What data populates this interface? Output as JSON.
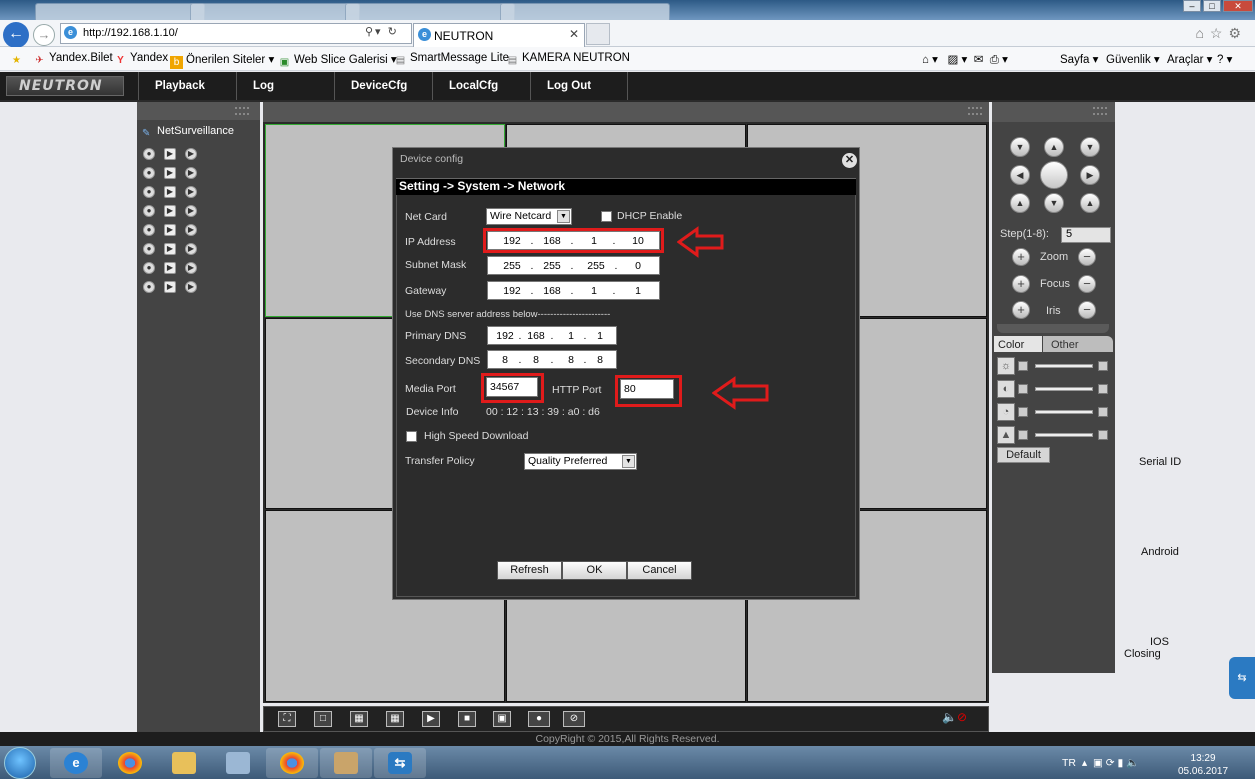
{
  "browser": {
    "url": "http://192.168.1.10/",
    "tab_title": "NEUTRON",
    "favorites": [
      {
        "label": "Yandex.Bilet",
        "icon": "airplane-icon"
      },
      {
        "label": "Yandex",
        "icon": "yandex-icon"
      },
      {
        "label": "Önerilen Siteler ▾",
        "icon": "suggested-sites-icon"
      },
      {
        "label": "Web Slice Galerisi ▾",
        "icon": "web-slice-icon"
      },
      {
        "label": "SmartMessage Lite",
        "icon": "page-icon"
      },
      {
        "label": "KAMERA NEUTRON",
        "icon": "page-icon"
      }
    ],
    "commands": {
      "page": "Sayfa ▾",
      "security": "Güvenlik ▾",
      "tools": "Araçlar ▾",
      "help": "? ▾"
    }
  },
  "app": {
    "logo": "NEUTRON",
    "menu": [
      "Playback",
      "Log",
      "DeviceCfg",
      "LocalCfg",
      "Log Out"
    ],
    "tree_title": "NetSurveillance",
    "copyright": "CopyRight © 2015,All Rights Reserved."
  },
  "ptz": {
    "step_label": "Step(1-8):",
    "step_value": "5",
    "zoom": "Zoom",
    "focus": "Focus",
    "iris": "Iris",
    "tab_color": "Color",
    "tab_other": "Other",
    "default_btn": "Default"
  },
  "side_labels": {
    "serial": "Serial ID",
    "android": "Android",
    "ios": "IOS",
    "closing": "Closing"
  },
  "dialog": {
    "title": "Device config",
    "path": "Setting -> System -> Network",
    "net_card_label": "Net Card",
    "net_card_value": "Wire Netcard",
    "dhcp_label": "DHCP Enable",
    "ip_label": "IP Address",
    "ip": [
      "192",
      "168",
      "1",
      "10"
    ],
    "subnet_label": "Subnet Mask",
    "subnet": [
      "255",
      "255",
      "255",
      "0"
    ],
    "gateway_label": "Gateway",
    "gateway": [
      "192",
      "168",
      "1",
      "1"
    ],
    "dns_note": "Use DNS server address below-----------------------",
    "primary_dns_label": "Primary DNS",
    "primary_dns": [
      "192",
      "168",
      "1",
      "1"
    ],
    "secondary_dns_label": "Secondary DNS",
    "secondary_dns": [
      "8",
      "8",
      "8",
      "8"
    ],
    "media_port_label": "Media Port",
    "media_port": "34567",
    "http_port_label": "HTTP Port",
    "http_port": "80",
    "device_info_label": "Device Info",
    "device_info": "00 : 12 : 13 : 39 : a0 : d6",
    "high_speed_label": "High Speed Download",
    "transfer_label": "Transfer Policy",
    "transfer_value": "Quality Preferred",
    "refresh": "Refresh",
    "ok": "OK",
    "cancel": "Cancel"
  },
  "taskbar": {
    "lang": "TR",
    "time": "13:29",
    "date": "05.06.2017"
  },
  "colors": {
    "annotation_red": "#e01b1b",
    "app_dark": "#1d1d1d",
    "panel": "#444444"
  }
}
